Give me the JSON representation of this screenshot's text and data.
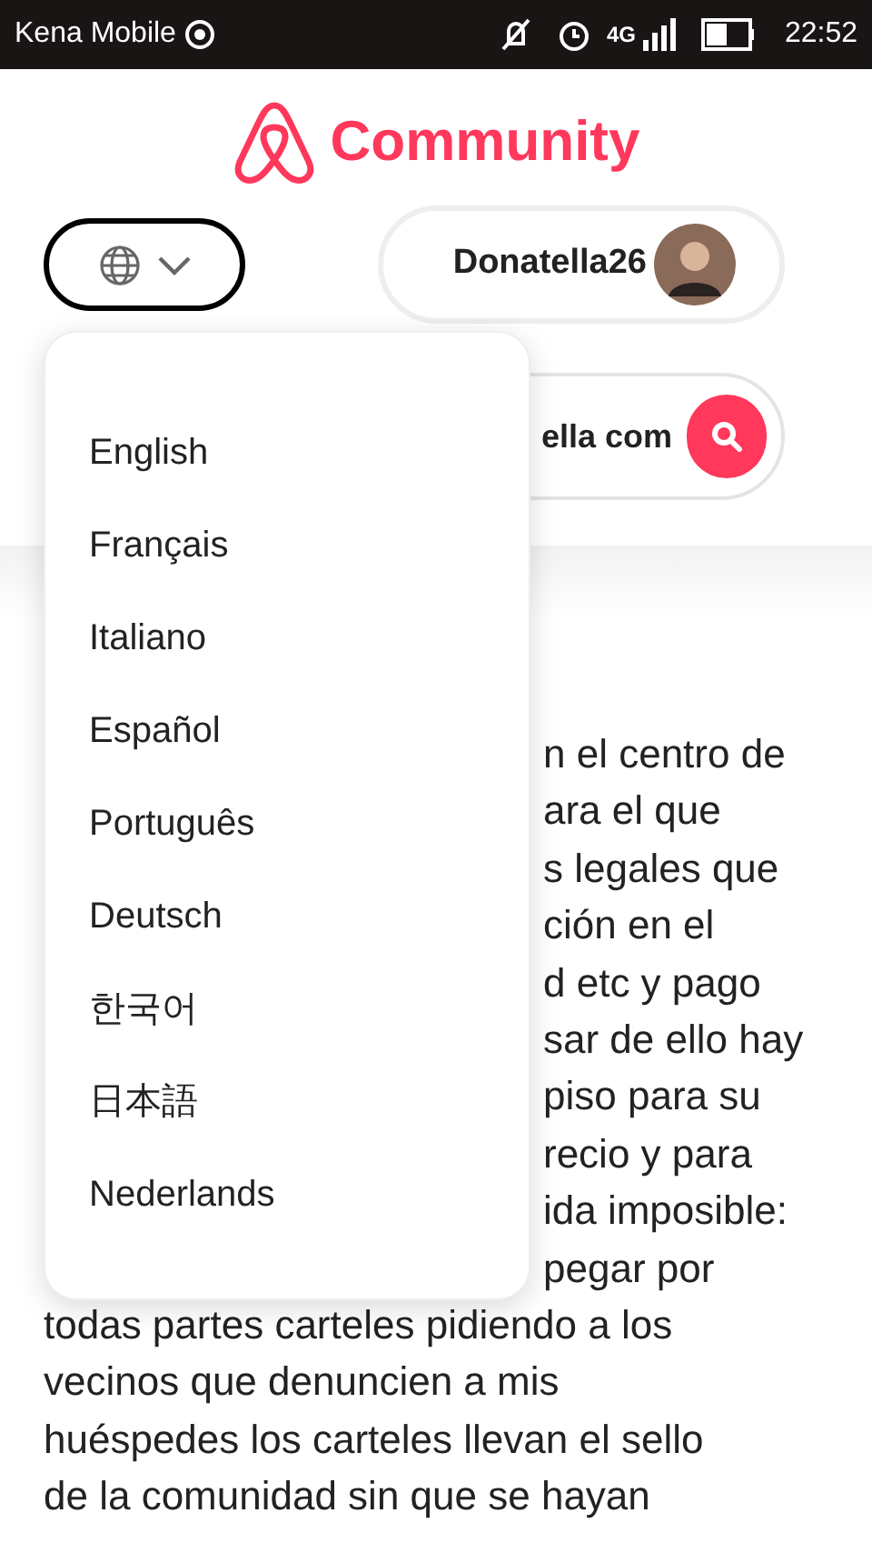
{
  "status_bar": {
    "carrier": "Kena Mobile",
    "network": "4G",
    "time": "22:52"
  },
  "header": {
    "logo_text": "Community",
    "user": {
      "name": "Donatella26"
    },
    "search": {
      "placeholder": "ella com"
    }
  },
  "language_menu": {
    "expanded": true,
    "items": [
      {
        "label": "English"
      },
      {
        "label": "Français"
      },
      {
        "label": "Italiano"
      },
      {
        "label": "Español"
      },
      {
        "label": "Português"
      },
      {
        "label": "Deutsch"
      },
      {
        "label": "한국어"
      },
      {
        "label": "日本語"
      },
      {
        "label": "Nederlands"
      }
    ]
  },
  "post": {
    "line_ends": [
      "n el centro de",
      "ara el que",
      "s legales que",
      "ción en el",
      "d etc y pago",
      "sar de ello hay",
      "piso para su",
      "recio y para",
      "ida imposible:",
      "pegar por"
    ],
    "lines": [
      "todas partes carteles pidiendo a los",
      "vecinos que denuncien a mis",
      "huéspedes los carteles llevan el sello",
      "de la comunidad sin que se hayan"
    ]
  }
}
